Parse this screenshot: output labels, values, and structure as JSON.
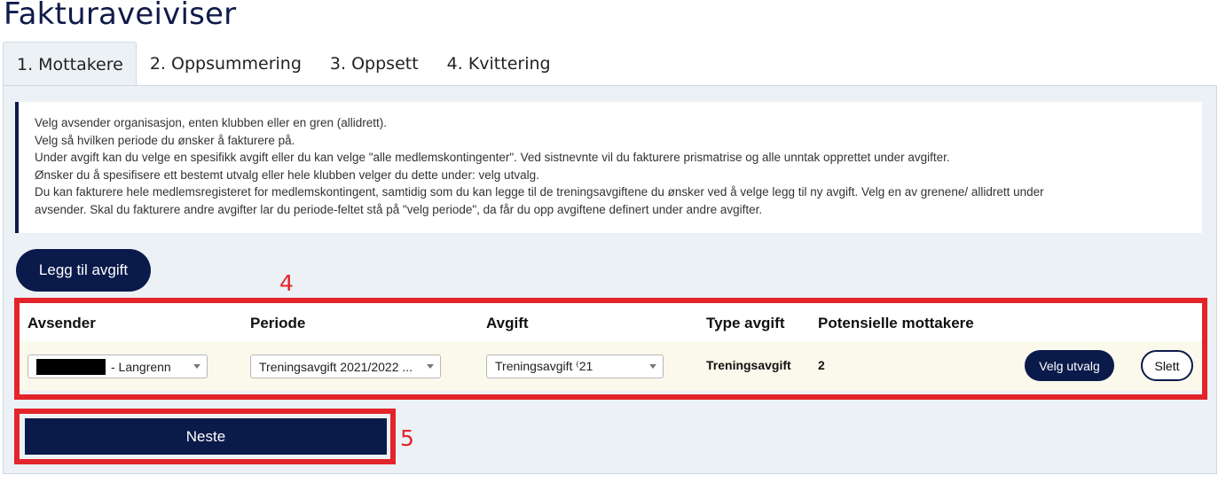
{
  "page": {
    "title": "Fakturaveiviser"
  },
  "tabs": [
    {
      "label": "1. Mottakere",
      "active": true
    },
    {
      "label": "2. Oppsummering",
      "active": false
    },
    {
      "label": "3. Oppsett",
      "active": false
    },
    {
      "label": "4. Kvittering",
      "active": false
    }
  ],
  "info": {
    "lines": [
      "Velg avsender organisasjon, enten klubben eller en gren (allidrett).",
      "Velg så hvilken periode du ønsker å fakturere på.",
      "Under avgift kan du velge en spesifikk avgift eller du kan velge \"alle medlemskontingenter\". Ved sistnevnte vil du fakturere prismatrise og alle unntak opprettet under avgifter.",
      "Ønsker du å spesifisere ett bestemt utvalg eller hele klubben velger du dette under: velg utvalg.",
      "Du kan fakturere hele medlemsregisteret for medlemskontingent, samtidig som du kan legge til de treningsavgiftene du ønsker ved å velge legg til ny avgift. Velg en av grenene/ allidrett under",
      "avsender. Skal du fakturere andre avgifter lar du periode-feltet stå på \"velg periode\", da får du opp avgiftene definert under andre avgifter."
    ]
  },
  "actions": {
    "add_fee_label": "Legg til avgift",
    "next_label": "Neste"
  },
  "annotations": {
    "table_marker": "4",
    "next_marker": "5",
    "color": "#e3242b"
  },
  "table": {
    "headers": {
      "sender": "Avsender",
      "period": "Periode",
      "fee": "Avgift",
      "fee_type": "Type avgift",
      "recipients": "Potensielle mottakere"
    },
    "row": {
      "sender_value": "- Langrenn",
      "period_value": "Treningsavgift 2021/2022 ...",
      "fee_value": "Treningsavgift ⁽21",
      "fee_type": "Treningsavgift",
      "recipients": "2",
      "select_label": "Velg utvalg",
      "delete_label": "Slett"
    }
  },
  "colors": {
    "brand_navy": "#0a1a4a",
    "panel_bg": "#ecf1f6",
    "row_bg": "#fbf8ec"
  },
  "icons": {
    "select_caret": "chevron-down-icon"
  }
}
